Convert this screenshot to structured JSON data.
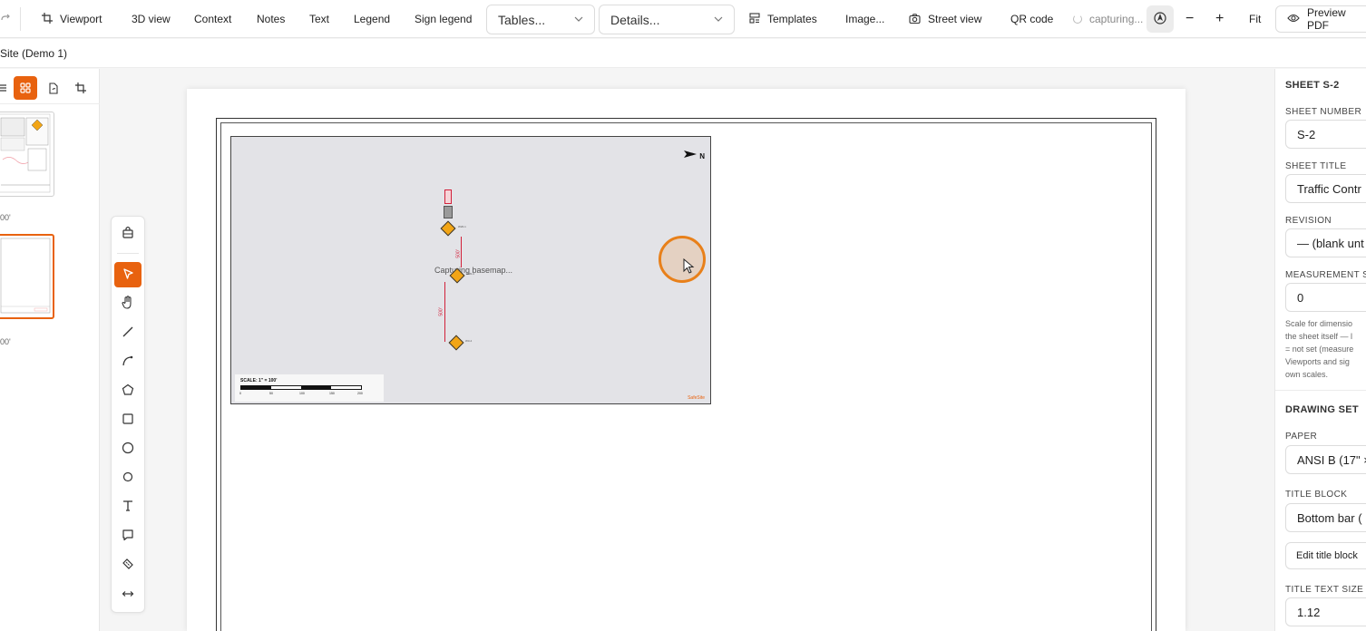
{
  "toolbar": {
    "viewport_label": "Viewport",
    "view3d_label": "3D view",
    "context_label": "Context",
    "notes_label": "Notes",
    "text_label": "Text",
    "legend_label": "Legend",
    "sign_legend_label": "Sign legend",
    "tables_select": "Tables...",
    "details_select": "Details...",
    "templates_label": "Templates",
    "image_label": "Image...",
    "street_view_label": "Street view",
    "qr_code_label": "QR code",
    "capturing_status": "capturing...",
    "zoom_out_label": "−",
    "zoom_in_label": "+",
    "fit_label": "Fit",
    "preview_label": "Preview PDF"
  },
  "project": {
    "name": "Site (Demo 1)"
  },
  "pages_panel": {
    "thumbnails": [
      {
        "scale_label": "00'"
      },
      {
        "scale_label": "00'"
      }
    ]
  },
  "sheet": {
    "viewport": {
      "status_text": "Capturing basemap...",
      "north_label": "N",
      "scale_label": "SCALE: 1\" = 100'",
      "scale_ticks": [
        "0",
        "50",
        "100",
        "150",
        "200"
      ],
      "brand": "SafeSite"
    }
  },
  "properties": {
    "section_title": "SHEET S-2",
    "sheet_number_label": "SHEET NUMBER",
    "sheet_number_value": "S-2",
    "sheet_title_label": "SHEET TITLE",
    "sheet_title_value": "Traffic Contr",
    "revision_label": "REVISION",
    "revision_value": "— (blank unt",
    "measurement_label": "MEASUREMENT S",
    "measurement_value": "0",
    "help_lines": [
      "Scale for dimensio",
      "the sheet itself — l",
      "= not set (measure",
      "Viewports and sig",
      "own scales."
    ],
    "drawing_set_title": "DRAWING SET",
    "paper_label": "PAPER",
    "paper_value": "ANSI B (17\" ×",
    "title_block_label": "TITLE BLOCK",
    "title_block_value": "Bottom bar (",
    "edit_title_block_label": "Edit title block",
    "title_text_size_label": "TITLE TEXT SIZE",
    "title_text_size_value": "1.12"
  },
  "colors": {
    "accent": "#e8620f",
    "cursor_ring": "#e8801a",
    "dimension": "#d2203a",
    "sign": "#f2a516"
  }
}
